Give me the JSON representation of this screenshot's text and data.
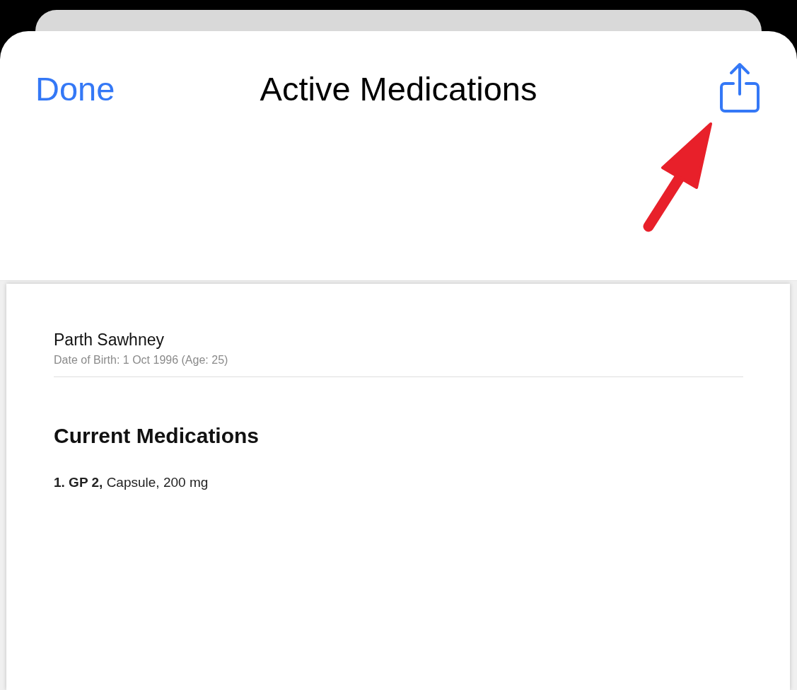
{
  "nav_bar": {
    "done_button": "Done",
    "title": "Active Medications"
  },
  "document": {
    "patient_name": "Parth Sawhney",
    "birth_info": "Date of Birth: 1 Oct 1996 (Age: 25)",
    "section_title": "Current Medications",
    "medications": [
      "**1. GP 2,** Capsule, 200 mg"
    ]
  }
}
